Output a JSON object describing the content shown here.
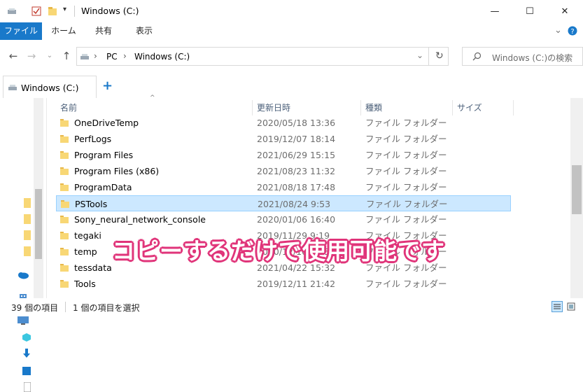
{
  "window": {
    "title": "Windows (C:)"
  },
  "ribbon": {
    "tabs": [
      "ファイル",
      "ホーム",
      "共有",
      "表示"
    ]
  },
  "address": {
    "crumbs": [
      "PC",
      "Windows (C:)"
    ]
  },
  "search": {
    "placeholder": "Windows (C:)の検索"
  },
  "tab": {
    "label": "Windows (C:)",
    "new_tab": "+"
  },
  "columns": {
    "name": "名前",
    "date": "更新日時",
    "type": "種類",
    "size": "サイズ"
  },
  "rows": [
    {
      "name": "OneDriveTemp",
      "date": "2020/05/18 13:36",
      "type": "ファイル フォルダー"
    },
    {
      "name": "PerfLogs",
      "date": "2019/12/07 18:14",
      "type": "ファイル フォルダー"
    },
    {
      "name": "Program Files",
      "date": "2021/06/29 15:15",
      "type": "ファイル フォルダー"
    },
    {
      "name": "Program Files (x86)",
      "date": "2021/08/23 11:32",
      "type": "ファイル フォルダー"
    },
    {
      "name": "ProgramData",
      "date": "2021/08/18 17:48",
      "type": "ファイル フォルダー"
    },
    {
      "name": "PSTools",
      "date": "2021/08/24 9:53",
      "type": "ファイル フォルダー",
      "selected": true
    },
    {
      "name": "Sony_neural_network_console",
      "date": "2020/01/06 16:40",
      "type": "ファイル フォルダー"
    },
    {
      "name": "tegaki",
      "date": "2019/11/29 9:19",
      "type": "ファイル フォルダー"
    },
    {
      "name": "temp",
      "date": "2020/12/10 12:56",
      "type": "ファイル フォルダー"
    },
    {
      "name": "tessdata",
      "date": "2021/04/22 15:32",
      "type": "ファイル フォルダー"
    },
    {
      "name": "Tools",
      "date": "2019/12/11 21:42",
      "type": "ファイル フォルダー"
    }
  ],
  "status": {
    "count": "39 個の項目",
    "selected": "1 個の項目を選択"
  },
  "overlay": {
    "text": "コピーするだけで使用可能です"
  },
  "colors": {
    "accent": "#1979ca",
    "selection": "#cce8ff",
    "folder": "#f8d775",
    "overlay_outline": "#e0357a"
  }
}
